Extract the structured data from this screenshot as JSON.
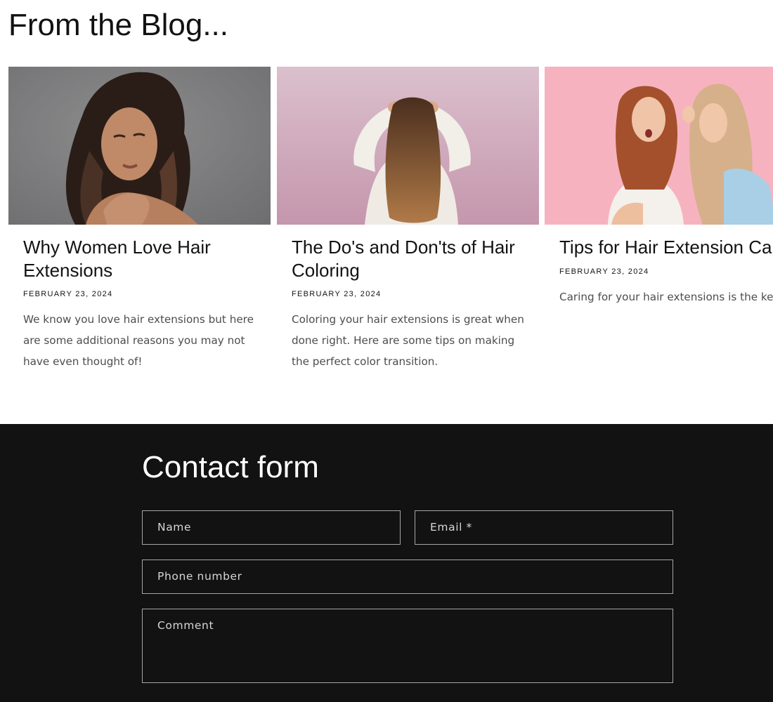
{
  "blog": {
    "heading": "From the Blog...",
    "posts": [
      {
        "title": "Why Women Love Hair Extensions",
        "date": "FEBRUARY 23, 2024",
        "excerpt": "We know you love hair extensions but here are some additional reasons you may not have even thought of!"
      },
      {
        "title": "The Do's and Don'ts of Hair Coloring",
        "date": "FEBRUARY 23, 2024",
        "excerpt": "Coloring your hair extensions is great when done right. Here are some tips on making the perfect color transition."
      },
      {
        "title": "Tips for Hair Extension Care",
        "date": "FEBRUARY 23, 2024",
        "excerpt": "Caring for your hair extensions is the key to making them look great and last!"
      }
    ]
  },
  "contact": {
    "heading": "Contact form",
    "name_placeholder": "Name",
    "email_placeholder": "Email *",
    "phone_placeholder": "Phone number",
    "comment_placeholder": "Comment"
  },
  "colors": {
    "text_dark": "#121212",
    "contact_bg": "#121212",
    "field_border": "#a6a6a6"
  }
}
